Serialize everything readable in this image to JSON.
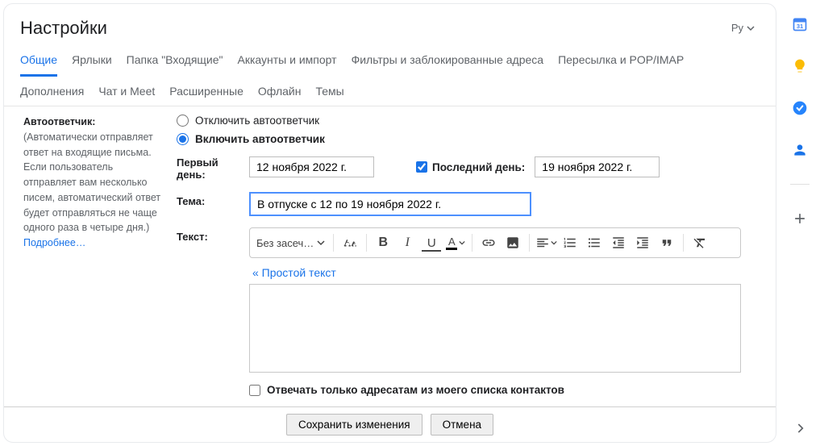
{
  "header": {
    "title": "Настройки",
    "lang_label": "Ру"
  },
  "tabs": [
    {
      "label": "Общие",
      "active": true
    },
    {
      "label": "Ярлыки"
    },
    {
      "label": "Папка \"Входящие\""
    },
    {
      "label": "Аккаунты и импорт"
    },
    {
      "label": "Фильтры и заблокированные адреса"
    },
    {
      "label": "Пересылка и POP/IMAP"
    },
    {
      "label": "Дополнения"
    },
    {
      "label": "Чат и Meet"
    },
    {
      "label": "Расширенные"
    },
    {
      "label": "Офлайн"
    },
    {
      "label": "Темы"
    }
  ],
  "autoresponder": {
    "section_title": "Автоответчик:",
    "description": "(Автоматически отправляет ответ на входящие письма. Если пользователь отправляет вам несколько писем, автоматический ответ будет отправляться не чаще одного раза в четыре дня.)",
    "learn_more": "Подробнее…",
    "radio_off": "Отключить автоответчик",
    "radio_on": "Включить автоответчик",
    "first_day_label": "Первый день:",
    "first_day_value": "12 ноября 2022 г.",
    "last_day_checkbox_label": "Последний день:",
    "last_day_value": "19 ноября 2022 г.",
    "subject_label": "Тема:",
    "subject_value": "В отпуске с 12 по 19 ноября 2022 г.",
    "text_label": "Текст:",
    "font_select": "Без засеч…",
    "plain_text_link": "« Простой текст",
    "contacts_only_label": "Отвечать только адресатам из моего списка контактов"
  },
  "footer": {
    "save": "Сохранить изменения",
    "cancel": "Отмена"
  },
  "sidepanel": {
    "calendar_day": "31"
  }
}
